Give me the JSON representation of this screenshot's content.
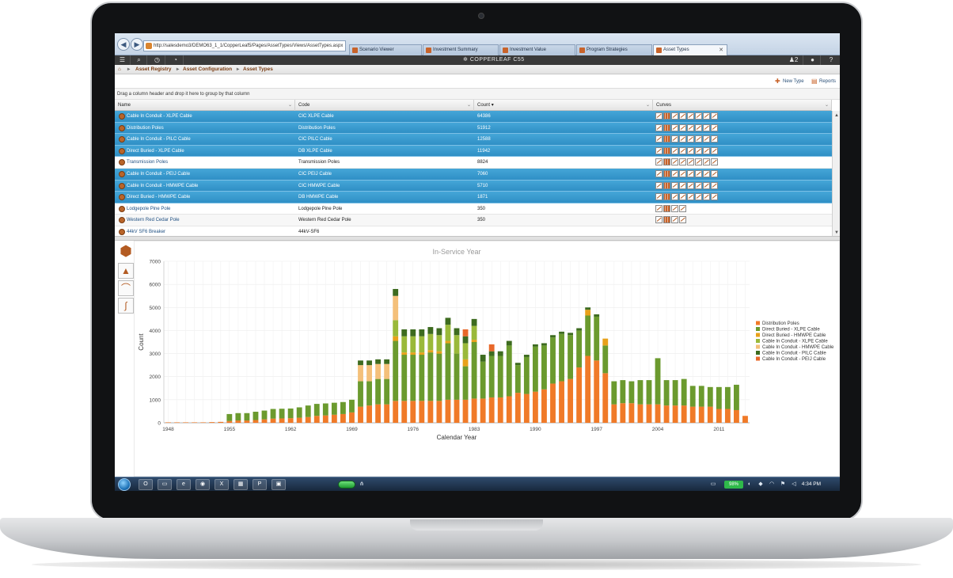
{
  "browser": {
    "url": "http://salesdemo3/DEMO63_1_1/CopperLeaf5/Pages/AssetTypes/Views/AssetTypes.aspx",
    "tabs": [
      {
        "label": "Scenario Viewer",
        "active": false
      },
      {
        "label": "Investment Summary",
        "active": false
      },
      {
        "label": "Investment Value",
        "active": false
      },
      {
        "label": "Program Strategies",
        "active": false
      },
      {
        "label": "Asset Types",
        "active": true
      }
    ]
  },
  "app": {
    "logo_text": "COPPERLEAF C55",
    "user_count": "2"
  },
  "breadcrumb": [
    "Asset Registry",
    "Asset Configuration",
    "Asset Types"
  ],
  "actions": {
    "new_type": "New Type",
    "reports": "Reports"
  },
  "grid": {
    "group_hint": "Drag a column header and drop it here to group by that column",
    "columns": [
      "Name",
      "Code",
      "Count",
      "Curves"
    ],
    "count_sort_glyph": "▾",
    "rows": [
      {
        "name": "Cable In Conduit - XLPE Cable",
        "code": "CIC XLPE Cable",
        "count": "64386",
        "selected": true,
        "curves": 8
      },
      {
        "name": "Distribution Poles",
        "code": "Distribution Poles",
        "count": "51912",
        "selected": true,
        "curves": 8
      },
      {
        "name": "Cable In Conduit - PILC Cable",
        "code": "CIC PILC Cable",
        "count": "12588",
        "selected": true,
        "curves": 8
      },
      {
        "name": "Direct Buried - XLPE Cable",
        "code": "DB XLPE Cable",
        "count": "11942",
        "selected": true,
        "curves": 8
      },
      {
        "name": "Transmission Poles",
        "code": "Transmission Poles",
        "count": "8824",
        "selected": false,
        "curves": 8
      },
      {
        "name": "Cable In Conduit - PEIJ Cable",
        "code": "CIC PEIJ Cable",
        "count": "7060",
        "selected": true,
        "curves": 8
      },
      {
        "name": "Cable In Conduit - HMWPE Cable",
        "code": "CIC HMWPE Cable",
        "count": "5710",
        "selected": true,
        "curves": 8
      },
      {
        "name": "Direct Buried - HMWPE Cable",
        "code": "DB HMWPE Cable",
        "count": "1871",
        "selected": true,
        "curves": 8
      },
      {
        "name": "Lodgepole Pine Pole",
        "code": "Lodgepole Pine Pole",
        "count": "350",
        "selected": false,
        "curves": 4
      },
      {
        "name": "Western Red Cedar Pole",
        "code": "Western Red Cedar Pole",
        "count": "350",
        "selected": false,
        "curves": 4
      },
      {
        "name": "44kV SF6 Breaker",
        "code": "44kV-SF6",
        "count": "",
        "selected": false,
        "curves": 0
      }
    ]
  },
  "chart_data": {
    "type": "bar",
    "stacked": true,
    "title": "In-Service Year",
    "xlabel": "Calendar Year",
    "ylabel": "Count",
    "ylim": [
      0,
      7000
    ],
    "yticks": [
      0,
      1000,
      2000,
      3000,
      4000,
      5000,
      6000,
      7000
    ],
    "xticks": [
      "1948",
      "1955",
      "1962",
      "1969",
      "1976",
      "1983",
      "1990",
      "1997",
      "2004",
      "2011"
    ],
    "legend_position": "right",
    "grid": true,
    "years": [
      1948,
      1949,
      1950,
      1951,
      1952,
      1953,
      1954,
      1955,
      1956,
      1957,
      1958,
      1959,
      1960,
      1961,
      1962,
      1963,
      1964,
      1965,
      1966,
      1967,
      1968,
      1969,
      1970,
      1971,
      1972,
      1973,
      1974,
      1975,
      1976,
      1977,
      1978,
      1979,
      1980,
      1981,
      1982,
      1983,
      1984,
      1985,
      1986,
      1987,
      1988,
      1989,
      1990,
      1991,
      1992,
      1993,
      1994,
      1995,
      1996,
      1997,
      1998,
      1999,
      2000,
      2001,
      2002,
      2003,
      2004,
      2005,
      2006,
      2007,
      2008,
      2009,
      2010,
      2011,
      2012,
      2013,
      2014
    ],
    "series": [
      {
        "name": "Distribution Poles",
        "color": "#f07a28",
        "values": [
          20,
          20,
          20,
          20,
          20,
          30,
          40,
          80,
          100,
          100,
          120,
          150,
          180,
          190,
          200,
          220,
          250,
          300,
          320,
          350,
          380,
          450,
          700,
          750,
          800,
          800,
          950,
          950,
          950,
          950,
          950,
          950,
          1000,
          1000,
          1000,
          1050,
          1050,
          1100,
          1100,
          1150,
          1300,
          1250,
          1350,
          1450,
          1700,
          1800,
          1900,
          2400,
          2900,
          2700,
          2150,
          800,
          850,
          850,
          800,
          800,
          800,
          750,
          750,
          750,
          700,
          700,
          700,
          600,
          600,
          550,
          300
        ]
      },
      {
        "name": "Direct Buried - XLPE Cable",
        "color": "#6b9a2e",
        "values": [
          0,
          0,
          0,
          0,
          0,
          0,
          0,
          300,
          320,
          320,
          360,
          380,
          420,
          420,
          420,
          450,
          500,
          520,
          520,
          520,
          520,
          550,
          1100,
          1050,
          1100,
          1100,
          2600,
          2000,
          2000,
          2000,
          2100,
          2050,
          2450,
          2000,
          1450,
          2450,
          1600,
          1800,
          1800,
          2200,
          1200,
          1600,
          1950,
          1900,
          2000,
          2050,
          1900,
          1600,
          1750,
          1900,
          1200,
          1000,
          1000,
          950,
          1050,
          1050,
          2000,
          1100,
          1100,
          1150,
          900,
          900,
          850,
          950,
          950,
          1100,
          0
        ]
      },
      {
        "name": "Direct Buried - HMWPE Cable",
        "color": "#e8a11a",
        "values": [
          0,
          0,
          0,
          0,
          0,
          0,
          0,
          0,
          0,
          0,
          0,
          0,
          0,
          0,
          0,
          0,
          0,
          0,
          0,
          0,
          0,
          0,
          0,
          0,
          0,
          0,
          200,
          100,
          100,
          100,
          100,
          100,
          100,
          0,
          300,
          100,
          0,
          0,
          0,
          0,
          0,
          0,
          0,
          0,
          0,
          0,
          0,
          0,
          250,
          0,
          300,
          0,
          0,
          0,
          0,
          0,
          0,
          0,
          0,
          0,
          0,
          0,
          0,
          0,
          0,
          0,
          0
        ]
      },
      {
        "name": "Cable In Conduit - XLPE Cable",
        "color": "#9ab93a",
        "values": [
          0,
          0,
          0,
          0,
          0,
          0,
          0,
          0,
          0,
          0,
          0,
          0,
          0,
          0,
          0,
          0,
          0,
          0,
          0,
          0,
          0,
          0,
          0,
          0,
          0,
          0,
          700,
          700,
          700,
          700,
          700,
          700,
          700,
          800,
          700,
          600,
          0,
          0,
          0,
          0,
          0,
          0,
          0,
          0,
          0,
          0,
          0,
          0,
          0,
          0,
          0,
          0,
          0,
          0,
          0,
          0,
          0,
          0,
          0,
          0,
          0,
          0,
          0,
          0,
          0,
          0,
          0
        ]
      },
      {
        "name": "Cable In Conduit - HMWPE Cable",
        "color": "#f4c07a",
        "values": [
          0,
          0,
          0,
          0,
          0,
          0,
          0,
          0,
          0,
          0,
          0,
          0,
          0,
          0,
          0,
          0,
          0,
          0,
          0,
          0,
          0,
          0,
          700,
          700,
          650,
          650,
          1050,
          0,
          0,
          0,
          0,
          0,
          0,
          0,
          0,
          0,
          0,
          0,
          0,
          0,
          0,
          0,
          0,
          0,
          0,
          0,
          0,
          0,
          0,
          0,
          0,
          0,
          0,
          0,
          0,
          0,
          0,
          0,
          0,
          0,
          0,
          0,
          0,
          0,
          0,
          0,
          0
        ]
      },
      {
        "name": "Cable In Conduit - PILC Cable",
        "color": "#3d6b1f",
        "values": [
          0,
          0,
          0,
          0,
          0,
          0,
          0,
          0,
          0,
          0,
          0,
          0,
          0,
          0,
          0,
          0,
          0,
          0,
          0,
          0,
          0,
          0,
          200,
          200,
          200,
          200,
          300,
          300,
          300,
          300,
          300,
          300,
          300,
          300,
          300,
          300,
          300,
          200,
          200,
          200,
          100,
          100,
          100,
          100,
          100,
          100,
          100,
          100,
          100,
          100,
          0,
          0,
          0,
          0,
          0,
          0,
          0,
          0,
          0,
          0,
          0,
          0,
          0,
          0,
          0,
          0,
          0
        ]
      },
      {
        "name": "Cable In Conduit - PEIJ Cable",
        "color": "#e8682a",
        "values": [
          0,
          0,
          0,
          0,
          0,
          0,
          0,
          0,
          0,
          0,
          0,
          0,
          0,
          0,
          0,
          0,
          0,
          0,
          0,
          0,
          0,
          0,
          0,
          0,
          0,
          0,
          0,
          0,
          0,
          0,
          0,
          0,
          0,
          0,
          300,
          0,
          0,
          300,
          0,
          0,
          0,
          0,
          0,
          0,
          0,
          0,
          0,
          0,
          0,
          0,
          0,
          0,
          0,
          0,
          0,
          0,
          0,
          0,
          0,
          0,
          0,
          0,
          0,
          0,
          0,
          0,
          0
        ]
      }
    ]
  },
  "taskbar": {
    "battery": "98%",
    "clock": "4:34 PM"
  }
}
